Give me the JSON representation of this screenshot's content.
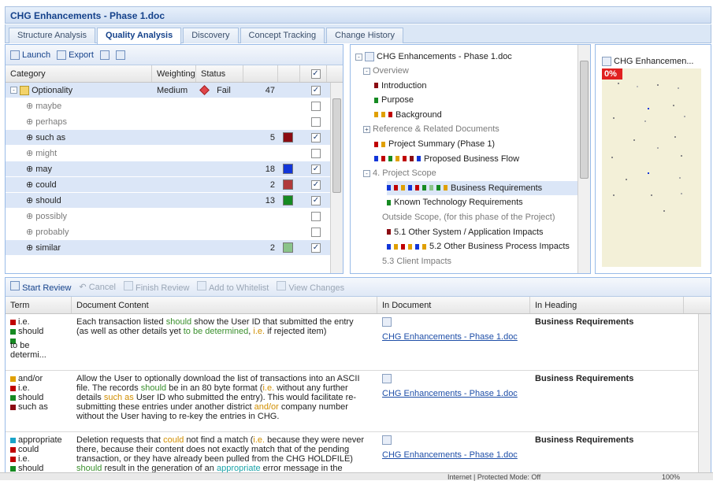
{
  "window": {
    "title": "CHG Enhancements - Phase 1.doc"
  },
  "tabs": [
    {
      "label": "Structure Analysis",
      "active": false
    },
    {
      "label": "Quality Analysis",
      "active": true
    },
    {
      "label": "Discovery",
      "active": false
    },
    {
      "label": "Concept Tracking",
      "active": false
    },
    {
      "label": "Change History",
      "active": false
    }
  ],
  "grid": {
    "toolbar": {
      "launch": "Launch",
      "export": "Export"
    },
    "headers": {
      "category": "Category",
      "weighting": "Weighting",
      "status": "Status"
    },
    "group": {
      "label": "Optionality",
      "weighting": "Medium",
      "status": "Fail",
      "count": "47",
      "checked": true
    },
    "rows": [
      {
        "label": "maybe",
        "count": "",
        "color": "",
        "checked": false,
        "sel": false
      },
      {
        "label": "perhaps",
        "count": "",
        "color": "",
        "checked": false,
        "sel": false
      },
      {
        "label": "such as",
        "count": "5",
        "color": "#8b0c13",
        "checked": true,
        "sel": true
      },
      {
        "label": "might",
        "count": "",
        "color": "",
        "checked": false,
        "sel": false
      },
      {
        "label": "may",
        "count": "18",
        "color": "#1236d8",
        "checked": true,
        "sel": true
      },
      {
        "label": "could",
        "count": "2",
        "color": "#b03a3a",
        "checked": true,
        "sel": true
      },
      {
        "label": "should",
        "count": "13",
        "color": "#168a22",
        "checked": true,
        "sel": true
      },
      {
        "label": "possibly",
        "count": "",
        "color": "",
        "checked": false,
        "sel": false
      },
      {
        "label": "probably",
        "count": "",
        "color": "",
        "checked": false,
        "sel": false
      },
      {
        "label": "similar",
        "count": "2",
        "color": "#8bc48a",
        "checked": true,
        "sel": true
      }
    ]
  },
  "tree": {
    "root": "CHG Enhancements - Phase 1.doc",
    "nodes": [
      {
        "label": "Overview",
        "dim": true,
        "sel": false,
        "exp": "-",
        "colors": []
      },
      {
        "label": "Introduction",
        "dim": false,
        "sel": false,
        "exp": "",
        "colors": [
          "#8b0c13"
        ]
      },
      {
        "label": "Purpose",
        "dim": false,
        "sel": false,
        "exp": "",
        "colors": [
          "#168a22"
        ]
      },
      {
        "label": "Background",
        "dim": false,
        "sel": false,
        "exp": "",
        "colors": [
          "#e0a000",
          "#e0a000",
          "#c00000"
        ]
      },
      {
        "label": "Reference & Related Documents",
        "dim": true,
        "sel": false,
        "exp": "+",
        "colors": []
      },
      {
        "label": "Project Summary (Phase 1)",
        "dim": false,
        "sel": false,
        "exp": "",
        "colors": [
          "#c00000",
          "#e0a000"
        ]
      },
      {
        "label": "Proposed Business Flow",
        "dim": false,
        "sel": false,
        "exp": "",
        "colors": [
          "#1236d8",
          "#c00000",
          "#168a22",
          "#e0a000",
          "#c00000",
          "#8b0c13",
          "#1236d8"
        ]
      },
      {
        "label": "4. Project Scope",
        "dim": true,
        "sel": false,
        "exp": "-",
        "colors": []
      },
      {
        "label": "Business Requirements",
        "dim": false,
        "sel": true,
        "exp": "",
        "colors": [
          "#1236d8",
          "#c00000",
          "#e0a000",
          "#1236d8",
          "#c00000",
          "#168a22",
          "#8bc48a",
          "#168a22",
          "#e0a000"
        ]
      },
      {
        "label": "Known Technology Requirements",
        "dim": false,
        "sel": false,
        "exp": "",
        "colors": [
          "#168a22"
        ]
      },
      {
        "label": "Outside Scope, (for this phase of the Project)",
        "dim": true,
        "sel": false,
        "exp": "",
        "colors": []
      },
      {
        "label": "5.1 Other System / Application Impacts",
        "dim": false,
        "sel": false,
        "exp": "",
        "colors": [
          "#8b0c13"
        ]
      },
      {
        "label": "5.2 Other Business Process Impacts",
        "dim": false,
        "sel": false,
        "exp": "",
        "colors": [
          "#1236d8",
          "#e0a000",
          "#c00000",
          "#e0a000",
          "#1236d8",
          "#e0a000"
        ]
      },
      {
        "label": "5.3 Client Impacts",
        "dim": true,
        "sel": false,
        "exp": "",
        "colors": []
      }
    ]
  },
  "preview": {
    "title": "CHG Enhancemen...",
    "percent": "0%"
  },
  "review": {
    "toolbar": {
      "start": "Start Review",
      "cancel": "Cancel",
      "finish": "Finish Review",
      "whitelist": "Add to Whitelist",
      "changes": "View Changes"
    },
    "headers": {
      "term": "Term",
      "content": "Document Content",
      "doc": "In Document",
      "heading": "In Heading"
    },
    "rows": [
      {
        "terms": [
          {
            "t": "i.e.",
            "c": "#c00000"
          },
          {
            "t": "should",
            "c": "#168a22"
          },
          {
            "t": "",
            "c": "#168a22"
          },
          {
            "t": "to be determi...",
            "c": ""
          }
        ],
        "content": [
          [
            {
              "t": "Each transaction listed "
            },
            {
              "t": "should",
              "h": "hl-green"
            },
            {
              "t": " show the User ID that submitted the entry"
            }
          ],
          [
            {
              "t": "(as well as other details yet "
            },
            {
              "t": "to be determined",
              "h": "hl-green"
            },
            {
              "t": ", "
            },
            {
              "t": "i.e.",
              "h": "hl-orange"
            },
            {
              "t": " if rejected item)"
            }
          ]
        ],
        "doc": "CHG Enhancements - Phase 1.doc",
        "heading": "Business Requirements"
      },
      {
        "terms": [
          {
            "t": "and/or",
            "c": "#e0a000"
          },
          {
            "t": "i.e.",
            "c": "#c00000"
          },
          {
            "t": "should",
            "c": "#168a22"
          },
          {
            "t": "such as",
            "c": "#8b0c13"
          }
        ],
        "content": [
          [
            {
              "t": "Allow the User to optionally download the list of transactions into an ASCII"
            }
          ],
          [
            {
              "t": "file. The records "
            },
            {
              "t": "should",
              "h": "hl-green"
            },
            {
              "t": " be in an 80 byte format ("
            },
            {
              "t": "i.e.",
              "h": "hl-orange"
            },
            {
              "t": " without any further"
            }
          ],
          [
            {
              "t": "details "
            },
            {
              "t": "such as",
              "h": "hl-orange"
            },
            {
              "t": " User ID who submitted the entry). This would facilitate re-"
            }
          ],
          [
            {
              "t": "submitting these entries under another district "
            },
            {
              "t": "and/or",
              "h": "hl-orange"
            },
            {
              "t": " company number"
            }
          ],
          [
            {
              "t": "without the User having to re-key the entries in CHG."
            }
          ]
        ],
        "doc": "CHG Enhancements - Phase 1.doc",
        "heading": "Business Requirements"
      },
      {
        "terms": [
          {
            "t": "appropriate",
            "c": "#1aa3c8"
          },
          {
            "t": "could",
            "c": "#c00000"
          },
          {
            "t": "i.e.",
            "c": "#c00000"
          },
          {
            "t": "should",
            "c": "#168a22"
          }
        ],
        "content": [
          [
            {
              "t": "Deletion requests that "
            },
            {
              "t": "could",
              "h": "hl-orange"
            },
            {
              "t": " not find a match ("
            },
            {
              "t": "i.e.",
              "h": "hl-orange"
            },
            {
              "t": " because they were never"
            }
          ],
          [
            {
              "t": "there, because their content does not exactly match that of the pending"
            }
          ],
          [
            {
              "t": "transaction, or they have already been pulled from the CHG HOLDFILE)"
            }
          ],
          [
            {
              "t": "should",
              "h": "hl-green"
            },
            {
              "t": " result in the generation of an "
            },
            {
              "t": "appropriate",
              "h": "hl-teal"
            },
            {
              "t": " error message in the"
            }
          ]
        ],
        "doc": "CHG Enhancements - Phase 1.doc",
        "heading": "Business Requirements"
      }
    ]
  },
  "statusbar": {
    "zone": "Internet | Protected Mode: Off",
    "zoom": "100%"
  }
}
